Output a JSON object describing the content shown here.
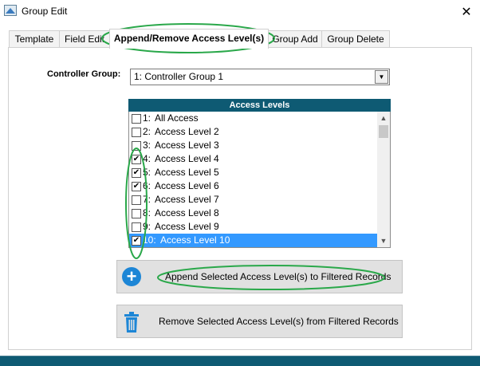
{
  "window": {
    "title": "Group Edit",
    "close_glyph": "✕"
  },
  "tabs": [
    {
      "label": "Template",
      "active": false
    },
    {
      "label": "Field Edit",
      "active": false
    },
    {
      "label": "Append/Remove Access Level(s)",
      "active": true
    },
    {
      "label": "Group Add",
      "active": false
    },
    {
      "label": "Group Delete",
      "active": false
    }
  ],
  "controller_group": {
    "label": "Controller Group:",
    "value": "1:  Controller Group 1"
  },
  "access_levels": {
    "header": "Access Levels",
    "items": [
      {
        "num": "1:",
        "label": "All Access",
        "checked": false
      },
      {
        "num": "2:",
        "label": "Access Level 2",
        "checked": false
      },
      {
        "num": "3:",
        "label": "Access Level 3",
        "checked": false
      },
      {
        "num": "4:",
        "label": "Access Level 4",
        "checked": true
      },
      {
        "num": "5:",
        "label": "Access Level 5",
        "checked": true
      },
      {
        "num": "6:",
        "label": "Access Level 6",
        "checked": true
      },
      {
        "num": "7:",
        "label": "Access Level 7",
        "checked": false
      },
      {
        "num": "8:",
        "label": "Access Level 8",
        "checked": false
      },
      {
        "num": "9:",
        "label": "Access Level 9",
        "checked": false
      },
      {
        "num": "10:",
        "label": "Access Level 10",
        "checked": true,
        "selected": true
      }
    ]
  },
  "buttons": {
    "append": {
      "label": "Append Selected Access Level(s) to Filtered Records",
      "icon": "plus-circle-icon"
    },
    "remove": {
      "label": "Remove Selected Access Level(s) from Filtered Records",
      "icon": "trash-icon"
    }
  },
  "colors": {
    "header_bg": "#0e5a73",
    "selection": "#3399ff",
    "annotation": "#2aa84a",
    "plus_icon": "#1d86d6"
  }
}
